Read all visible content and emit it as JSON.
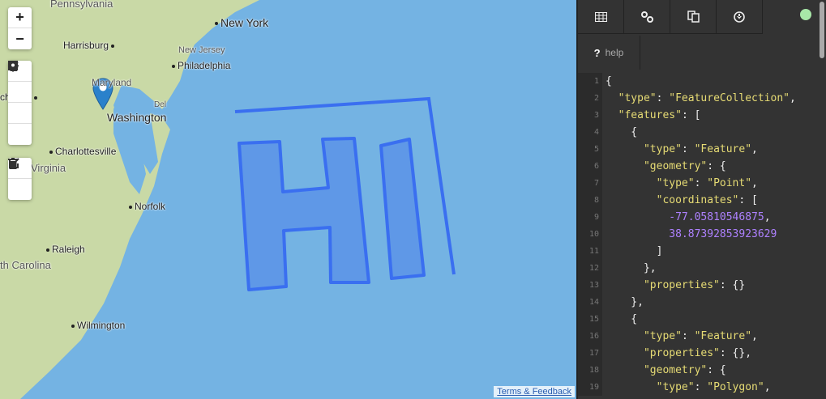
{
  "map": {
    "labels": {
      "pennsylvania": "Pennsylvania",
      "new_york": "New York",
      "harrisburg": "Harrisburg",
      "new_jersey": "New Jersey",
      "philadelphia": "Philadelphia",
      "maryland": "Maryland",
      "winchester": "chester",
      "washington": "Washington",
      "del": "Del",
      "charlottesville": "Charlottesville",
      "virginia": "Virginia",
      "norfolk": "Norfolk",
      "raleigh": "Raleigh",
      "north_carolina": "th Carolina",
      "wilmington": "Wilmington"
    },
    "controls": {
      "zoom_in": "+",
      "zoom_out": "−"
    },
    "terms": "Terms & Feedback",
    "colors": {
      "water": "#74b3e3",
      "land": "#c9d9a6",
      "feature": "#3a6ff0"
    }
  },
  "panel": {
    "tabs": [
      {
        "icon": "table-icon"
      },
      {
        "icon": "link-icon"
      },
      {
        "icon": "copy-icon"
      },
      {
        "icon": "download-icon"
      }
    ],
    "help_icon": "?",
    "help_label": "help",
    "code": [
      [
        [
          "p",
          "{"
        ]
      ],
      [
        [
          "p",
          "  "
        ],
        [
          "s",
          "\"type\""
        ],
        [
          "p",
          ": "
        ],
        [
          "s",
          "\"FeatureCollection\""
        ],
        [
          "p",
          ","
        ]
      ],
      [
        [
          "p",
          "  "
        ],
        [
          "s",
          "\"features\""
        ],
        [
          "p",
          ": ["
        ]
      ],
      [
        [
          "p",
          "    {"
        ]
      ],
      [
        [
          "p",
          "      "
        ],
        [
          "s",
          "\"type\""
        ],
        [
          "p",
          ": "
        ],
        [
          "s",
          "\"Feature\""
        ],
        [
          "p",
          ","
        ]
      ],
      [
        [
          "p",
          "      "
        ],
        [
          "s",
          "\"geometry\""
        ],
        [
          "p",
          ": {"
        ]
      ],
      [
        [
          "p",
          "        "
        ],
        [
          "s",
          "\"type\""
        ],
        [
          "p",
          ": "
        ],
        [
          "s",
          "\"Point\""
        ],
        [
          "p",
          ","
        ]
      ],
      [
        [
          "p",
          "        "
        ],
        [
          "s",
          "\"coordinates\""
        ],
        [
          "p",
          ": ["
        ]
      ],
      [
        [
          "p",
          "          "
        ],
        [
          "n",
          "-77.05810546875"
        ],
        [
          "p",
          ","
        ]
      ],
      [
        [
          "p",
          "          "
        ],
        [
          "n",
          "38.87392853923629"
        ]
      ],
      [
        [
          "p",
          "        ]"
        ]
      ],
      [
        [
          "p",
          "      },"
        ]
      ],
      [
        [
          "p",
          "      "
        ],
        [
          "s",
          "\"properties\""
        ],
        [
          "p",
          ": {}"
        ]
      ],
      [
        [
          "p",
          "    },"
        ]
      ],
      [
        [
          "p",
          "    {"
        ]
      ],
      [
        [
          "p",
          "      "
        ],
        [
          "s",
          "\"type\""
        ],
        [
          "p",
          ": "
        ],
        [
          "s",
          "\"Feature\""
        ],
        [
          "p",
          ","
        ]
      ],
      [
        [
          "p",
          "      "
        ],
        [
          "s",
          "\"properties\""
        ],
        [
          "p",
          ": {},"
        ]
      ],
      [
        [
          "p",
          "      "
        ],
        [
          "s",
          "\"geometry\""
        ],
        [
          "p",
          ": {"
        ]
      ],
      [
        [
          "p",
          "        "
        ],
        [
          "s",
          "\"type\""
        ],
        [
          "p",
          ": "
        ],
        [
          "s",
          "\"Polygon\""
        ],
        [
          "p",
          ","
        ]
      ]
    ]
  }
}
